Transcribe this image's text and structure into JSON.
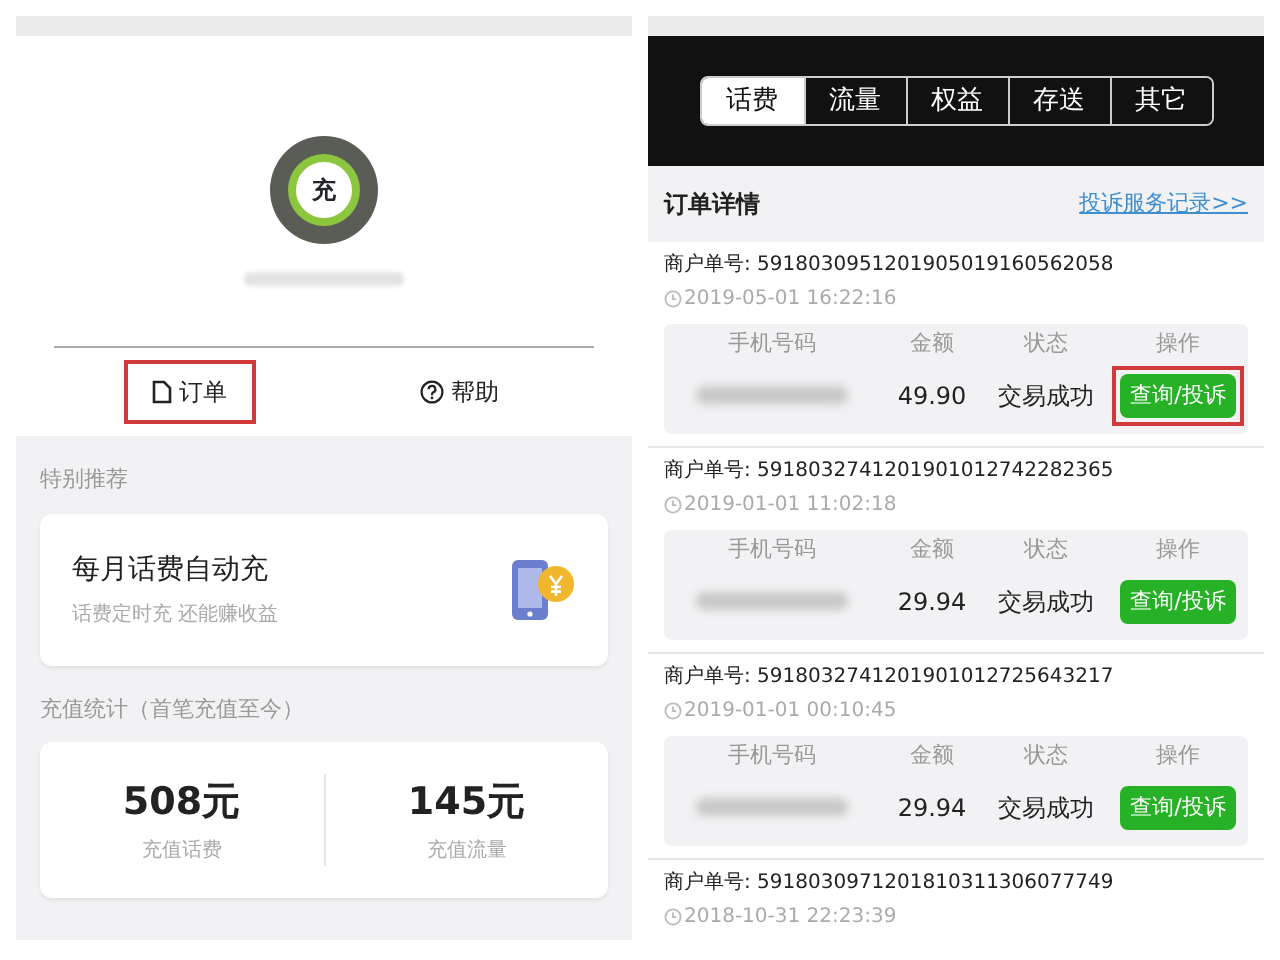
{
  "left_screen": {
    "avatar": {
      "label": "充"
    },
    "tabs": [
      {
        "label": "订单",
        "highlighted": true
      },
      {
        "label": "帮助",
        "highlighted": false
      }
    ],
    "section_title": "特别推荐",
    "promo": {
      "title": "每月话费自动充",
      "subtitle": "话费定时充 还能赚收益"
    },
    "stats_title": "充值统计（首笔充值至今）",
    "stats": [
      {
        "value": "508元",
        "label": "充值话费"
      },
      {
        "value": "145元",
        "label": "充值流量"
      }
    ]
  },
  "right_screen": {
    "tabs": [
      {
        "label": "话费",
        "selected": true
      },
      {
        "label": "流量",
        "selected": false
      },
      {
        "label": "权益",
        "selected": false
      },
      {
        "label": "存送",
        "selected": false
      },
      {
        "label": "其它",
        "selected": false
      }
    ],
    "header": {
      "title": "订单详情",
      "link": "投诉服务记录>>"
    },
    "orders": [
      {
        "merchant_no": "商户单号: 5918030951201905019160562058",
        "time": "2019-05-01 16:22:16",
        "columns": [
          "手机号码",
          "金额",
          "状态",
          "操作"
        ],
        "amount": "49.90",
        "status": "交易成功",
        "action": "查询/投诉",
        "highlighted": true
      },
      {
        "merchant_no": "商户单号: 5918032741201901012742282365",
        "time": "2019-01-01 11:02:18",
        "columns": [
          "手机号码",
          "金额",
          "状态",
          "操作"
        ],
        "amount": "29.94",
        "status": "交易成功",
        "action": "查询/投诉",
        "highlighted": false
      },
      {
        "merchant_no": "商户单号: 5918032741201901012725643217",
        "time": "2019-01-01 00:10:45",
        "columns": [
          "手机号码",
          "金额",
          "状态",
          "操作"
        ],
        "amount": "29.94",
        "status": "交易成功",
        "action": "查询/投诉",
        "highlighted": false
      },
      {
        "merchant_no": "商户单号: 5918030971201810311306077749",
        "time": "2018-10-31 22:23:39"
      }
    ]
  }
}
